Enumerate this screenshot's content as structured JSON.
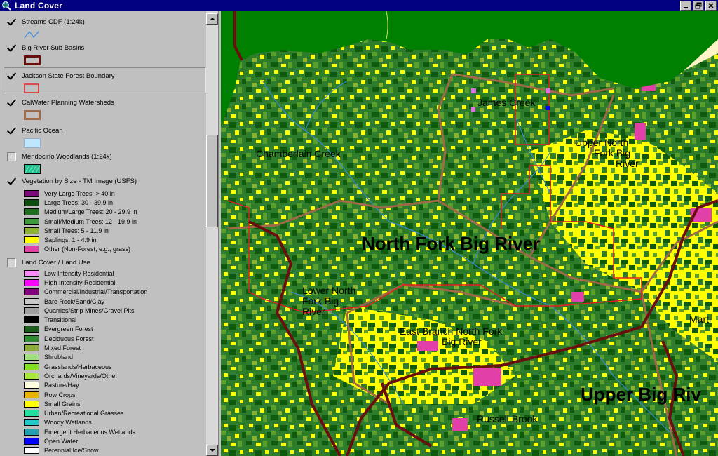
{
  "window": {
    "title": "Land Cover"
  },
  "toc": {
    "layers": [
      {
        "name": "Streams CDF (1:24k)",
        "checked": true
      },
      {
        "name": "Big River Sub Basins",
        "checked": true
      },
      {
        "name": "Jackson State Forest Boundary",
        "checked": true
      },
      {
        "name": "CalWater Planning Watersheds",
        "checked": true
      },
      {
        "name": "Pacific Ocean",
        "checked": true
      },
      {
        "name": "Mendocino Woodlands (1:24k)",
        "checked": false
      },
      {
        "name": "Vegetation by Size - TM Image (USFS)",
        "checked": true
      },
      {
        "name": "Land Cover / Land Use",
        "checked": false
      }
    ],
    "vegetation_legend": [
      {
        "label": "Very Large Trees: > 40  in",
        "color": "#7b0a7b"
      },
      {
        "label": "Large Trees: 30 - 39.9 in",
        "color": "#0d4d0d"
      },
      {
        "label": "Medium/Large Trees: 20 - 29.9 in",
        "color": "#1f6e1f"
      },
      {
        "label": "Small/Medium Trees: 12 - 19.9 in",
        "color": "#3c9a3c"
      },
      {
        "label": "Small Trees: 5 - 11.9 in",
        "color": "#8cb030"
      },
      {
        "label": "Saplings: 1 - 4.9 in",
        "color": "#ffff00"
      },
      {
        "label": "Other (Non-Forest, e.g., grass)",
        "color": "#e040a8"
      }
    ],
    "landcover_legend": [
      {
        "label": "Low Intensity Residential",
        "color": "#f78cf7"
      },
      {
        "label": "High Intensity Residential",
        "color": "#ff00ff"
      },
      {
        "label": "Commercial/Industrial/Transportation",
        "color": "#800080"
      },
      {
        "label": "Bare Rock/Sand/Clay",
        "color": "#c8c8c8"
      },
      {
        "label": "Quarries/Strip Mines/Gravel Pits",
        "color": "#a0a0a0"
      },
      {
        "label": "Transitional",
        "color": "#000000"
      },
      {
        "label": "Evergreen Forest",
        "color": "#1a5c1a"
      },
      {
        "label": "Deciduous Forest",
        "color": "#2e8b2e"
      },
      {
        "label": "Mixed Forest",
        "color": "#8caa3a"
      },
      {
        "label": "Shrubland",
        "color": "#a0e080"
      },
      {
        "label": "Grasslands/Herbaceous",
        "color": "#7fe020"
      },
      {
        "label": "Orchards/Vineyards/Other",
        "color": "#a8e838"
      },
      {
        "label": "Pasture/Hay",
        "color": "#ffffe0"
      },
      {
        "label": "Row Crops",
        "color": "#e8b000"
      },
      {
        "label": "Small Grains",
        "color": "#ffff00"
      },
      {
        "label": "Urban/Recreational Grasses",
        "color": "#20e0a0"
      },
      {
        "label": "Woody Wetlands",
        "color": "#20c8c8"
      },
      {
        "label": "Emergent Herbaceous Wetlands",
        "color": "#20a0b0"
      },
      {
        "label": "Open Water",
        "color": "#0000ff"
      },
      {
        "label": "Perennial Ice/Snow",
        "color": "#ffffff"
      }
    ]
  },
  "map": {
    "labels": [
      "James Creek",
      "Upper North",
      "Fork Big",
      "River",
      "Chamberlain Creek",
      "North Fork Big River",
      "Lower North",
      "Fork Big",
      "River",
      "East Branch North Fork",
      "Big River",
      "Marti",
      "Upper Big Riv",
      "Russell Brook"
    ],
    "colors": {
      "outside": "#008000",
      "forest_dark": "#0f5a0f",
      "forest_mid": "#2d7d2d",
      "forest_light": "#5aa02a",
      "saplings": "#ffff00",
      "other": "#e040a8",
      "ocean": "#fff5c8",
      "streams": "#3a8ad8",
      "subbasin": "#6a0e0e",
      "watershed": "#a06a48",
      "forest_boundary": "#e02020"
    }
  }
}
